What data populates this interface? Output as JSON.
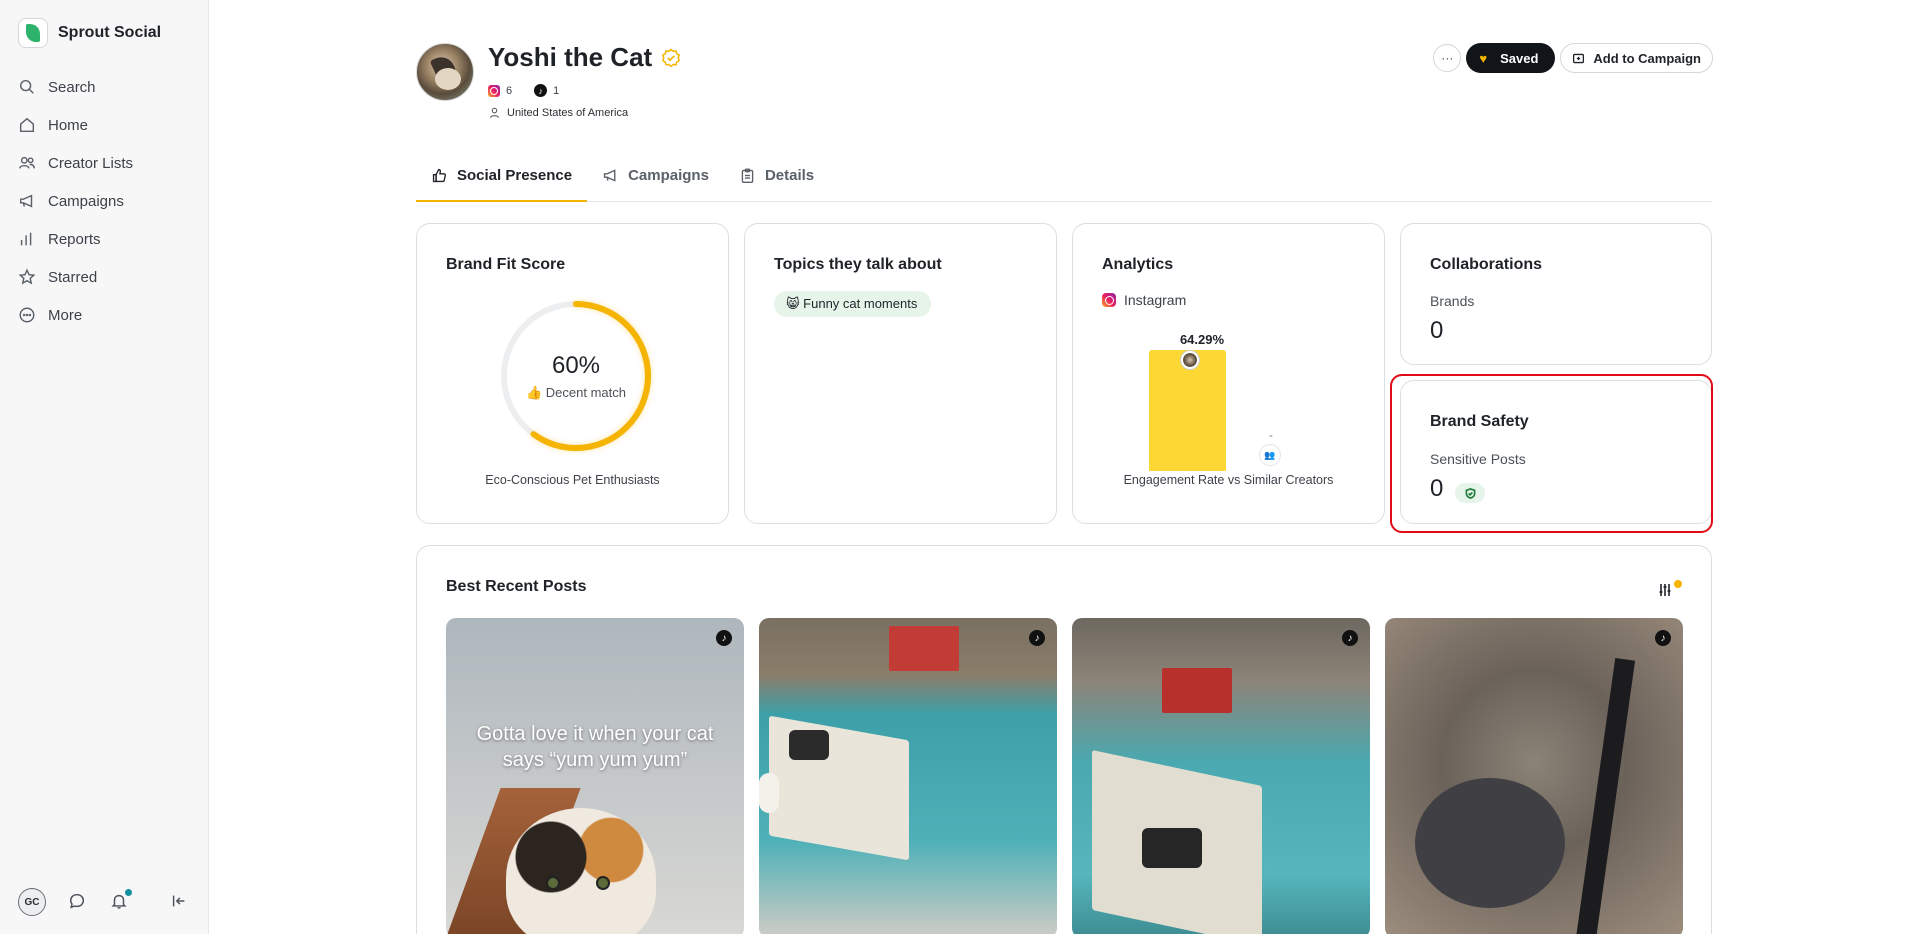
{
  "app": {
    "name": "Sprout Social"
  },
  "sidebar": {
    "items": [
      {
        "label": "Search",
        "icon": "search-icon"
      },
      {
        "label": "Home",
        "icon": "home-icon"
      },
      {
        "label": "Creator Lists",
        "icon": "users-icon"
      },
      {
        "label": "Campaigns",
        "icon": "megaphone-icon"
      },
      {
        "label": "Reports",
        "icon": "bar-chart-icon"
      },
      {
        "label": "Starred",
        "icon": "star-icon"
      },
      {
        "label": "More",
        "icon": "more-circle-icon"
      }
    ],
    "user_initials": "GC"
  },
  "profile": {
    "name": "Yoshi the Cat",
    "instagram_count": "6",
    "tiktok_count": "1",
    "location": "United States of America"
  },
  "actions": {
    "more_label": "···",
    "saved_label": "Saved",
    "add_campaign_label": "Add to Campaign"
  },
  "tabs": [
    {
      "label": "Social Presence",
      "active": true
    },
    {
      "label": "Campaigns",
      "active": false
    },
    {
      "label": "Details",
      "active": false
    }
  ],
  "brand_fit": {
    "title": "Brand Fit Score",
    "score_text": "60%",
    "score": 60,
    "match_label": "👍 Decent match",
    "caption": "Eco-Conscious Pet Enthusiasts"
  },
  "topics": {
    "title": "Topics they talk about",
    "chips": [
      "😸 Funny cat moments"
    ]
  },
  "analytics": {
    "title": "Analytics",
    "platform": "Instagram",
    "caption": "Engagement Rate vs Similar Creators"
  },
  "chart_data": {
    "type": "bar",
    "categories": [
      "Creator",
      "Similar Creators"
    ],
    "values": [
      64.29,
      null
    ],
    "value_labels": [
      "64.29%",
      "-"
    ],
    "ylim": [
      0,
      100
    ],
    "xlabel": "Engagement Rate vs Similar Creators",
    "colors": [
      "#fdd835",
      "#e0e0e0"
    ]
  },
  "collaborations": {
    "title": "Collaborations",
    "metric_label": "Brands",
    "metric_value": "0"
  },
  "brand_safety": {
    "title": "Brand Safety",
    "metric_label": "Sensitive Posts",
    "metric_value": "0"
  },
  "best_posts": {
    "title": "Best Recent Posts",
    "posts": [
      {
        "platform": "tiktok",
        "caption": "Gotta love it when your cat says “yum yum yum”"
      },
      {
        "platform": "tiktok",
        "caption": ""
      },
      {
        "platform": "tiktok",
        "caption": ""
      },
      {
        "platform": "tiktok",
        "caption": ""
      }
    ]
  },
  "colors": {
    "accent": "#f5b400",
    "highlight": "#e10b16",
    "chip_bg": "#e6f4ea"
  }
}
